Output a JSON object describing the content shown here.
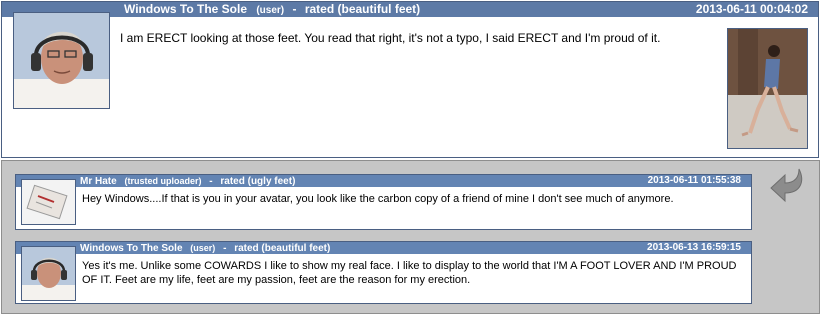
{
  "main_comment": {
    "author": "Windows To The Sole",
    "role": "(user)",
    "separator": "-",
    "rating": "rated (beautiful feet)",
    "date": "2013-06-11 00:04:02",
    "text": "I am ERECT looking at those feet. You read that right, it's not a typo, I said ERECT and I'm proud of it."
  },
  "replies": [
    {
      "author": "Mr Hate",
      "role": "(trusted uploader)",
      "separator": "-",
      "rating": "rated (ugly feet)",
      "date": "2013-06-11 01:55:38",
      "text": "Hey Windows....If that is you in your avatar, you look like the carbon copy of a friend of mine I don't see much of anymore."
    },
    {
      "author": "Windows To The Sole",
      "role": "(user)",
      "separator": "-",
      "rating": "rated (beautiful feet)",
      "date": "2013-06-13 16:59:15",
      "text": "Yes it's me. Unlike some COWARDS I like to show my real face. I like to display to the world that I'M A FOOT LOVER AND I'M PROUD OF IT. Feet are my life, feet are my passion, feet are the reason for my erection."
    }
  ],
  "icons": {
    "reply_arrow": "reply-arrow-icon"
  },
  "colors": {
    "header_main": "#5d7aa6",
    "header_reply": "#6384b3",
    "reply_bg": "#c6c6c6",
    "border": "#4a5f82"
  }
}
